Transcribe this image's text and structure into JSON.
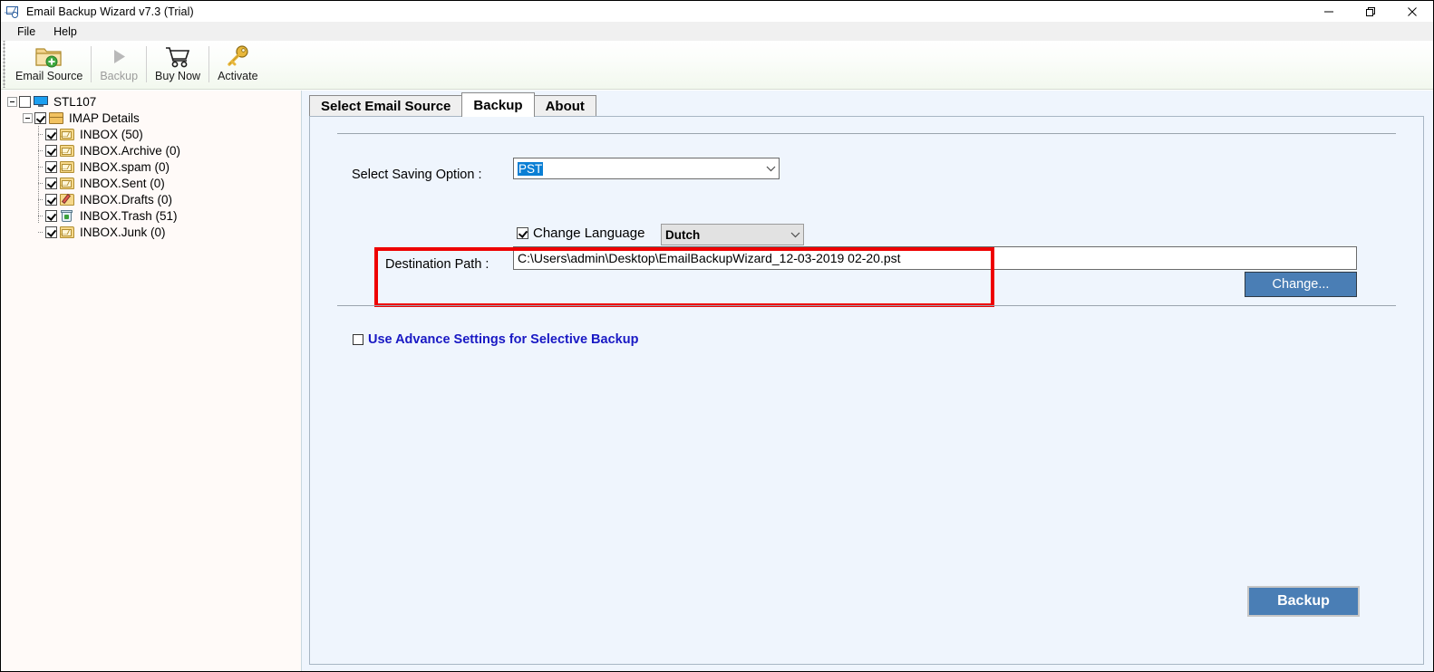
{
  "window": {
    "title": "Email Backup Wizard v7.3 (Trial)",
    "icon": "mail-wizard-icon",
    "controls": [
      {
        "name": "minimize-button",
        "glyph": "—"
      },
      {
        "name": "maximize-button",
        "glyph": "❐"
      },
      {
        "name": "close-button",
        "glyph": "✕"
      }
    ]
  },
  "menubar": {
    "items": [
      {
        "label": "File"
      },
      {
        "label": "Help"
      }
    ]
  },
  "toolbar": {
    "items": [
      {
        "label": "Email Source",
        "icon": "folder-add-icon",
        "disabled": false
      },
      {
        "label": "Backup",
        "icon": "play-triangle-icon",
        "disabled": true
      },
      {
        "label": "Buy Now",
        "icon": "shopping-cart-icon",
        "disabled": false
      },
      {
        "label": "Activate",
        "icon": "key-icon",
        "disabled": false
      }
    ]
  },
  "sidebar": {
    "tree": [
      {
        "label": "STL107",
        "icon": "monitor-icon",
        "checked": false,
        "level": 0,
        "expander": true
      },
      {
        "label": "IMAP Details",
        "icon": "package-icon",
        "checked": true,
        "level": 1,
        "expander": true
      },
      {
        "label": "INBOX (50)",
        "icon": "mail-folder-icon",
        "checked": true,
        "level": 2,
        "expander": false
      },
      {
        "label": "INBOX.Archive (0)",
        "icon": "mail-folder-icon",
        "checked": true,
        "level": 2,
        "expander": false
      },
      {
        "label": "INBOX.spam (0)",
        "icon": "mail-folder-icon",
        "checked": true,
        "level": 2,
        "expander": false
      },
      {
        "label": "INBOX.Sent (0)",
        "icon": "mail-folder-icon",
        "checked": true,
        "level": 2,
        "expander": false
      },
      {
        "label": "INBOX.Drafts (0)",
        "icon": "drafts-pencil-icon",
        "checked": true,
        "level": 2,
        "expander": false
      },
      {
        "label": "INBOX.Trash (51)",
        "icon": "trash-icon",
        "checked": true,
        "level": 2,
        "expander": false
      },
      {
        "label": "INBOX.Junk (0)",
        "icon": "mail-folder-icon",
        "checked": true,
        "level": 2,
        "expander": false
      }
    ]
  },
  "tabs": [
    {
      "label": "Select Email Source",
      "active": false
    },
    {
      "label": "Backup",
      "active": true
    },
    {
      "label": "About",
      "active": false
    }
  ],
  "backup_panel": {
    "saving_option_label": "Select Saving Option :",
    "saving_option_value": "PST",
    "saving_option_selected": true,
    "change_language_label": "Change Language",
    "change_language_checked": true,
    "language_value": "Dutch",
    "destination_label": "Destination Path :",
    "destination_value": "C:\\Users\\admin\\Desktop\\EmailBackupWizard_12-03-2019 02-20.pst",
    "change_button_label": "Change...",
    "advance_settings_label": "Use Advance Settings for Selective Backup",
    "advance_settings_checked": false,
    "backup_button_label": "Backup"
  },
  "colors": {
    "accent_button": "#4a7eb5",
    "panel_background": "#eff5fd",
    "sidebar_background": "#fffaf8",
    "highlight_box": "#ee0000",
    "selection_blue": "#0b7fd4",
    "link_blue": "#1919c4"
  }
}
